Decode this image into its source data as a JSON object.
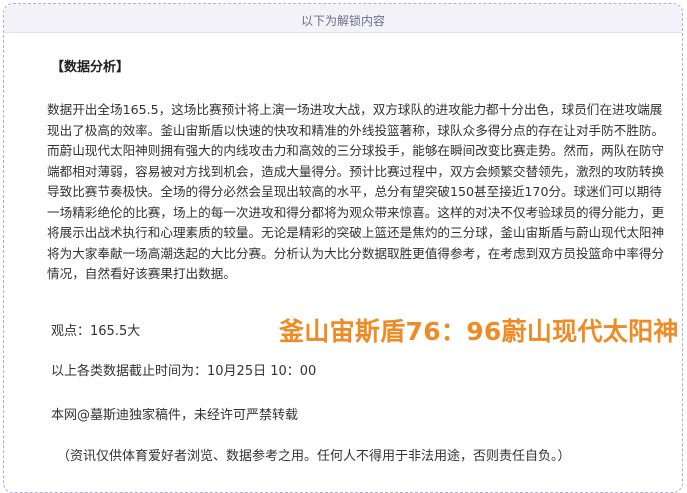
{
  "header": {
    "title": "以下为解锁内容"
  },
  "article": {
    "heading": "【数据分析】",
    "paragraph": "数据开出全场165.5，这场比赛预计将上演一场进攻大战，双方球队的进攻能力都十分出色，球员们在进攻端展现出了极高的效率。釜山宙斯盾以快速的快攻和精准的外线投篮著称，球队众多得分点的存在让对手防不胜防。而蔚山现代太阳神则拥有强大的内线攻击力和高效的三分球投手，能够在瞬间改变比赛走势。然而，两队在防守端都相对薄弱，容易被对方找到机会，造成大量得分。预计比赛过程中，双方会频繁交替领先，激烈的攻防转换导致比赛节奏极快。全场的得分必然会呈现出较高的水平，总分有望突破150甚至接近170分。球迷们可以期待一场精彩绝伦的比赛，场上的每一次进攻和得分都将为观众带来惊喜。这样的对决不仅考验球员的得分能力，更将展示出战术执行和心理素质的较量。无论是精彩的突破上篮还是焦灼的三分球，釜山宙斯盾与蔚山现代太阳神将为大家奉献一场高潮迭起的大比分赛。分析认为大比分数据取胜更值得参考，在考虑到双方员投篮命中率得分情况，自然看好该赛果打出数据。",
    "opinion": "观点：165.5大",
    "score": "釜山宙斯盾76：96蔚山现代太阳神",
    "cutoff": "以上各类数据截止时间为：10月25日 10：00",
    "copyright": "本网@墓斯迪独家稿件，未经许可严禁转载",
    "disclaimer": "（资讯仅供体育爱好者浏览、数据参考之用。任何人不得用于非法用途，否则责任自负。）"
  }
}
